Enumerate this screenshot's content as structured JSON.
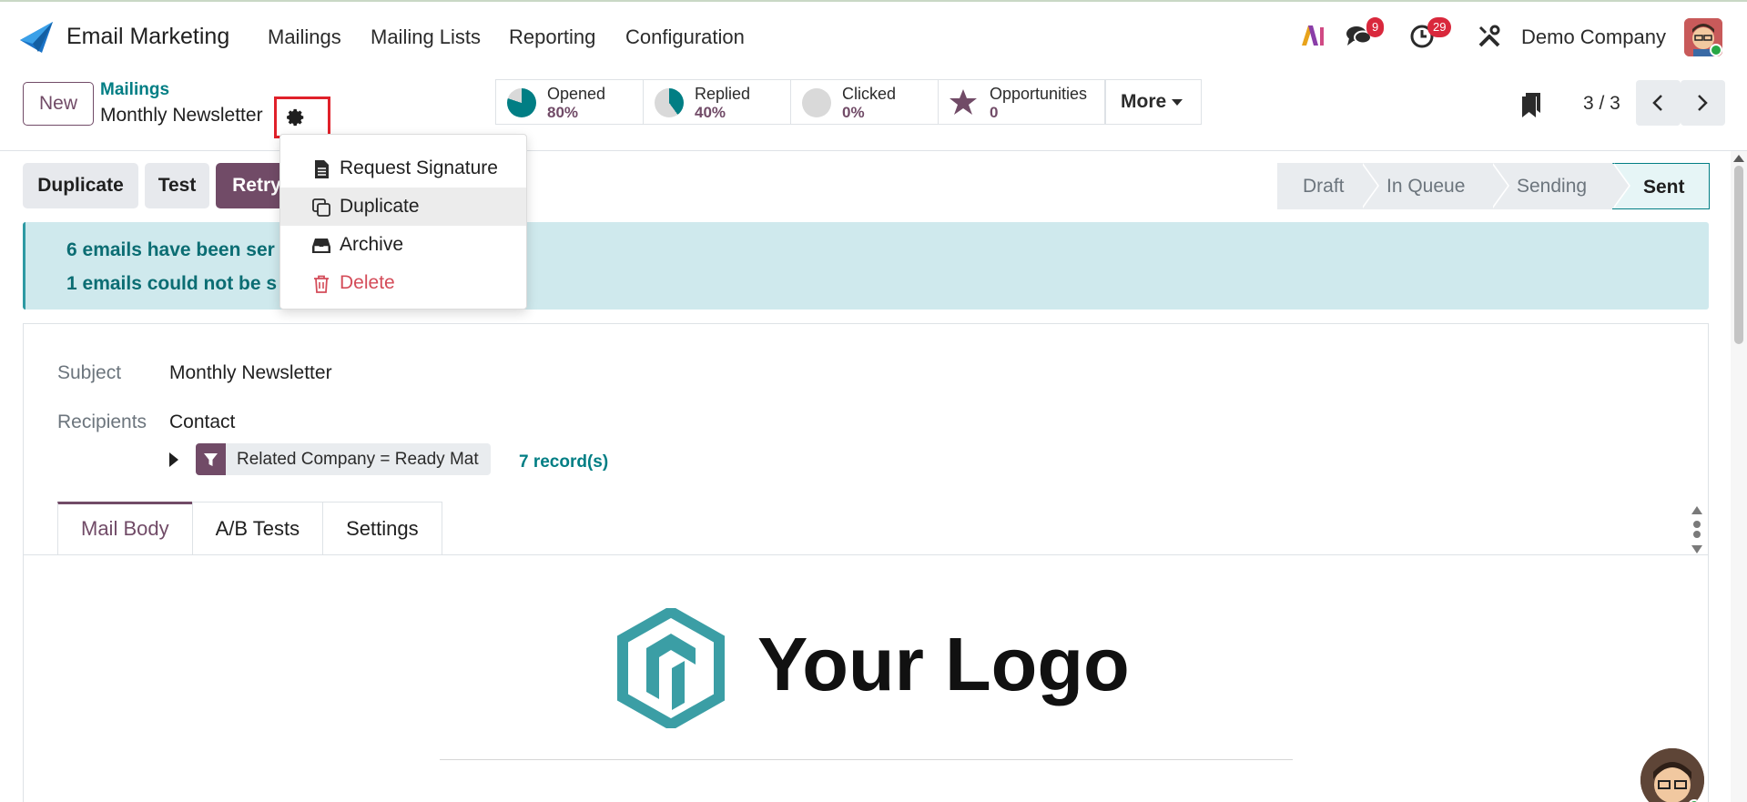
{
  "topbar": {
    "app_title": "Email Marketing",
    "nav": [
      "Mailings",
      "Mailing Lists",
      "Reporting",
      "Configuration"
    ],
    "messages_badge": "9",
    "activities_badge": "29",
    "company": "Demo Company"
  },
  "control": {
    "new_label": "New",
    "breadcrumb": "Mailings",
    "record_name": "Monthly Newsletter",
    "stats": [
      {
        "label": "Opened",
        "value": "80%",
        "fraction": 0.8
      },
      {
        "label": "Replied",
        "value": "40%",
        "fraction": 0.4
      },
      {
        "label": "Clicked",
        "value": "0%",
        "fraction": 0
      },
      {
        "label": "Opportunities",
        "value": "0"
      }
    ],
    "more_label": "More",
    "pager": "3 / 3"
  },
  "actions": {
    "duplicate": "Duplicate",
    "test": "Test",
    "retry": "Retry"
  },
  "stages": [
    "Draft",
    "In Queue",
    "Sending",
    "Sent"
  ],
  "current_stage": "Sent",
  "alert": {
    "line1": "6  emails have been ser",
    "line2": "1  emails could not be s"
  },
  "form": {
    "subject_label": "Subject",
    "subject_value": "Monthly Newsletter",
    "recipients_label": "Recipients",
    "recipients_value": "Contact",
    "domain_rule": "Related Company = Ready Mat",
    "records_link": "7 record(s)"
  },
  "tabs": [
    "Mail Body",
    "A/B Tests",
    "Settings"
  ],
  "active_tab": "Mail Body",
  "body": {
    "logo_text": "Your Logo"
  },
  "dropdown": {
    "items": [
      {
        "label": "Request Signature",
        "icon": "file-text-icon"
      },
      {
        "label": "Duplicate",
        "icon": "copy-icon"
      },
      {
        "label": "Archive",
        "icon": "archive-icon"
      },
      {
        "label": "Delete",
        "icon": "trash-icon"
      }
    ]
  },
  "colors": {
    "primary": "#714b67",
    "teal": "#017e84",
    "alert_bg": "#cfe9ed",
    "danger": "#d44c59",
    "highlight_box": "#e0212a"
  }
}
